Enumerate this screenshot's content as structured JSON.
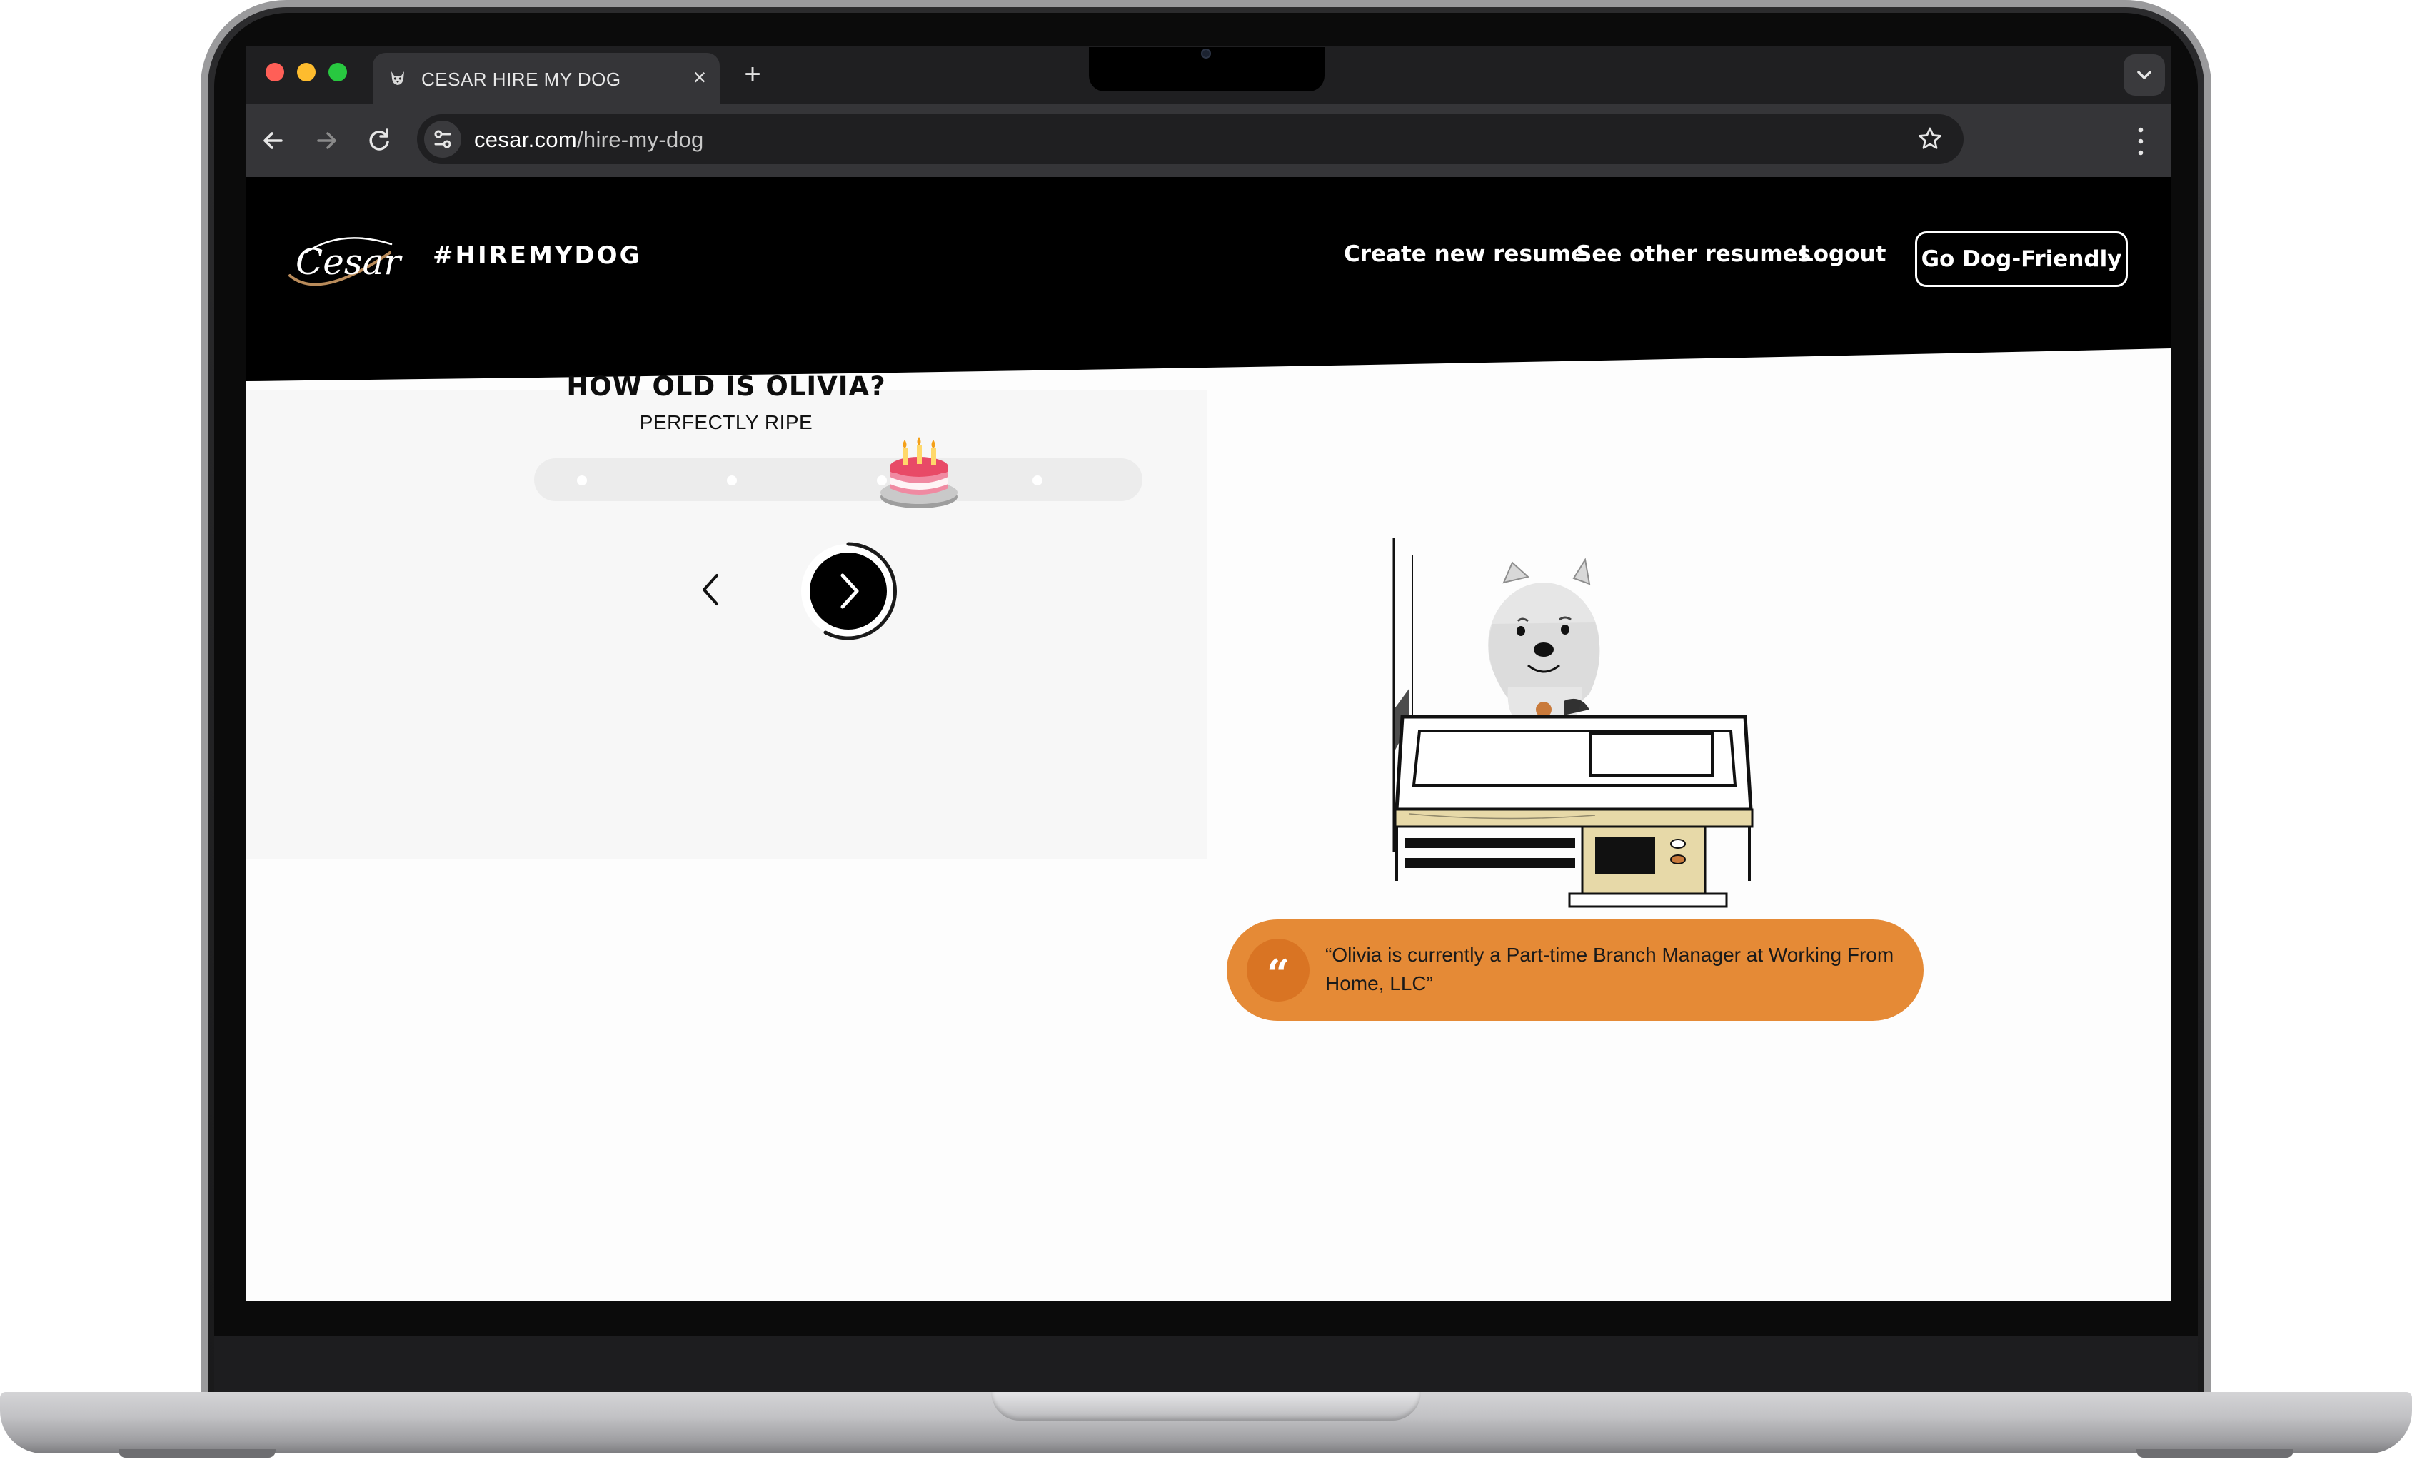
{
  "browser": {
    "tab_title": "CESAR HIRE MY DOG",
    "tab_close": "×",
    "new_tab": "+",
    "url_host": "cesar.com",
    "url_path": "/hire-my-dog"
  },
  "header": {
    "logo_text": "Cesar",
    "hashtag": "#HIREMYDOG",
    "nav": {
      "create": "Create new resume",
      "see": "See other resumes",
      "logout": "Logout"
    },
    "cta": "Go Dog-Friendly"
  },
  "question": {
    "title": "HOW OLD IS OLIVIA?",
    "answer": "PERFECTLY RIPE",
    "slider_steps": 4,
    "slider_selected_index": 2
  },
  "quote": {
    "mark": "“",
    "text": "“Olivia is currently a Part-time Branch Manager at Working From Home, LLC”"
  },
  "colors": {
    "accent_orange": "#e58a36",
    "header_black": "#000000"
  },
  "icons": {
    "back": "arrow-left-icon",
    "forward": "arrow-right-icon",
    "reload": "reload-icon",
    "site_info": "tune-icon",
    "bookmark": "star-icon",
    "menu": "kebab-icon",
    "slider_thumb": "birthday-cake-icon",
    "prev": "chevron-left-icon",
    "next": "chevron-right-icon",
    "quote": "quote-icon"
  }
}
